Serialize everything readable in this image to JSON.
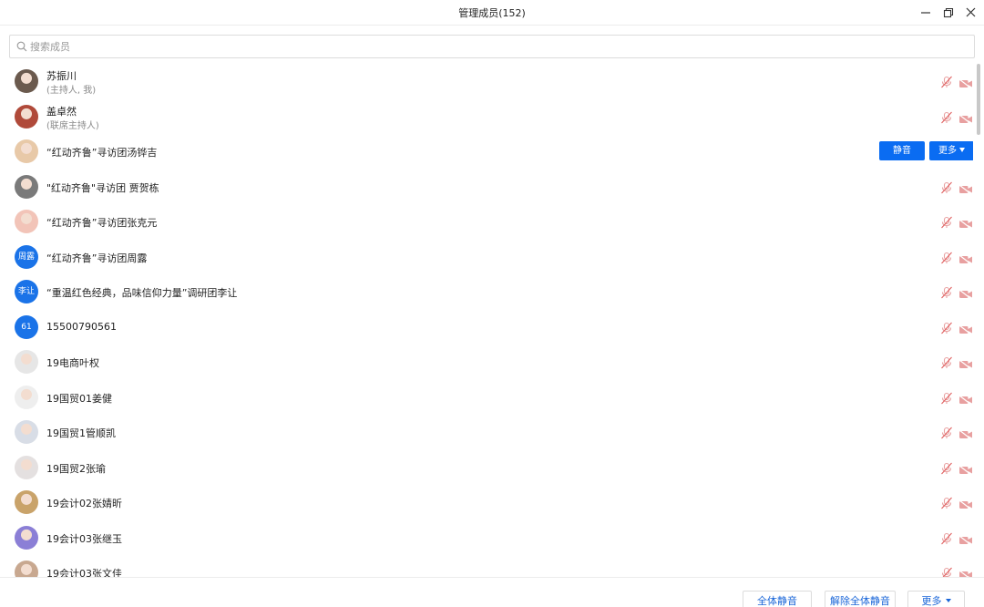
{
  "window": {
    "title": "管理成员(152)"
  },
  "search": {
    "placeholder": "搜索成员"
  },
  "members": [
    {
      "name": "苏振川",
      "subtitle": "(主持人, 我)",
      "avatar_type": "photo",
      "avatar_color": "#6b5a4e"
    },
    {
      "name": "盖卓然",
      "subtitle": "(联席主持人)",
      "avatar_type": "photo",
      "avatar_color": "#b04a3a"
    },
    {
      "name": "“红动齐鲁”寻访团汤铧吉",
      "avatar_type": "photo",
      "avatar_color": "#e8c9a8",
      "hovered": true
    },
    {
      "name": "\"红动齐鲁\"寻访团 贾贺栋",
      "avatar_type": "photo",
      "avatar_color": "#7a7a7a"
    },
    {
      "name": "“红动齐鲁”寻访团张克元",
      "avatar_type": "photo",
      "avatar_color": "#f2c4b8"
    },
    {
      "name": "“红动齐鲁”寻访团周露",
      "avatar_type": "text",
      "avatar_text": "周露"
    },
    {
      "name": "“重温红色经典，品味信仰力量”调研团李让",
      "avatar_type": "text",
      "avatar_text": "李让"
    },
    {
      "name": "15500790561",
      "avatar_type": "text",
      "avatar_text": "61"
    },
    {
      "name": "19电商叶权",
      "avatar_type": "photo",
      "avatar_color": "#e6e6e6"
    },
    {
      "name": "19国贸01姜健",
      "avatar_type": "photo",
      "avatar_color": "#eeeeee"
    },
    {
      "name": "19国贸1管顺凯",
      "avatar_type": "photo",
      "avatar_color": "#d8dde6"
    },
    {
      "name": "19国贸2张瑜",
      "avatar_type": "photo",
      "avatar_color": "#e4e0e0"
    },
    {
      "name": "19会计02张婧昕",
      "avatar_type": "photo",
      "avatar_color": "#c9a36a"
    },
    {
      "name": "19会计03张继玉",
      "avatar_type": "photo",
      "avatar_color": "#8b7fd6"
    },
    {
      "name": "19会计03张文佳",
      "avatar_type": "photo",
      "avatar_color": "#c8a890"
    }
  ],
  "row_actions": {
    "mute_label": "静音",
    "more_label": "更多"
  },
  "footer": {
    "mute_all_label": "全体静音",
    "unmute_all_label": "解除全体静音",
    "more_label": "更多"
  },
  "colors": {
    "accent": "#0a6cf2",
    "muted_icon": "#e8a0a0",
    "text_avatar_bg": "#1a73e8"
  }
}
